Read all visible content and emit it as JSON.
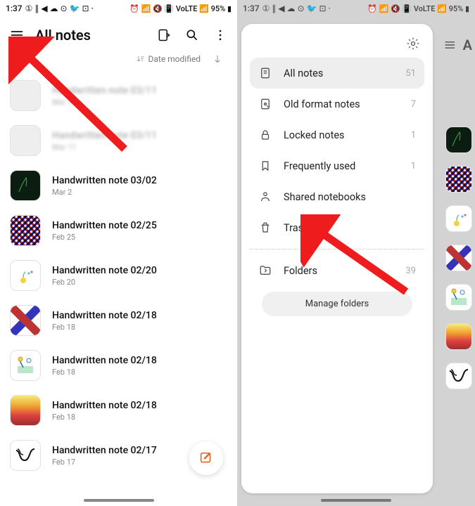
{
  "status": {
    "time": "1:37",
    "indicators_left": "① ∥ ◀ ☁ ⊙ 🐦 ⊡ ·",
    "indicators_right": "⏰ 📶 🔇 📳 VoLTE 📶 95% ▮"
  },
  "left": {
    "title": "All notes",
    "sort_label": "Date modified",
    "notes": [
      {
        "title": "Handwritten note 03/11",
        "date": "Mar 11",
        "thumb": "blank",
        "blur": true
      },
      {
        "title": "Handwritten note 03/11",
        "date": "Mar 11",
        "thumb": "blank",
        "blur": true
      },
      {
        "title": "Handwritten note 03/02",
        "date": "Mar 2",
        "thumb": "black"
      },
      {
        "title": "Handwritten note 02/25",
        "date": "Feb 25",
        "thumb": "pattern"
      },
      {
        "title": "Handwritten note 02/20",
        "date": "Feb 20",
        "thumb": "flower"
      },
      {
        "title": "Handwritten note 02/18",
        "date": "Feb 18",
        "thumb": "xpat"
      },
      {
        "title": "Handwritten note 02/18",
        "date": "Feb 18",
        "thumb": "notes2"
      },
      {
        "title": "Handwritten note 02/18",
        "date": "Feb 18",
        "thumb": "grad"
      },
      {
        "title": "Handwritten note 02/17",
        "date": "Feb 17",
        "thumb": "squig"
      }
    ]
  },
  "drawer": {
    "items": [
      {
        "icon": "note",
        "label": "All notes",
        "count": "51",
        "active": true
      },
      {
        "icon": "old",
        "label": "Old format notes",
        "count": "7"
      },
      {
        "icon": "lock",
        "label": "Locked notes",
        "count": "1"
      },
      {
        "icon": "bookmark",
        "label": "Frequently used",
        "count": "1"
      },
      {
        "icon": "share",
        "label": "Shared notebooks",
        "count": ""
      },
      {
        "icon": "trash",
        "label": "Trash",
        "count": ""
      }
    ],
    "folders_label": "Folders",
    "folders_count": "39",
    "manage_label": "Manage folders"
  },
  "right_header_initial": "A"
}
